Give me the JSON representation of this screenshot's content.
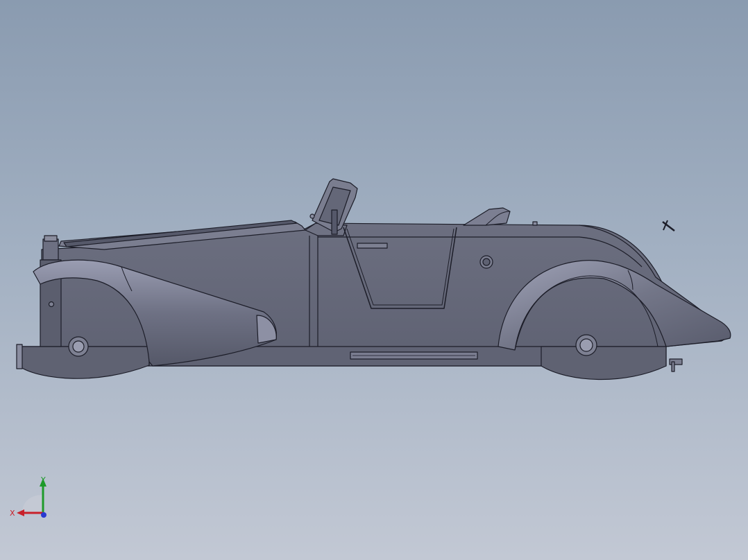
{
  "viewport": {
    "background_top": "#8a9bb0",
    "background_bottom": "#c2c8d4"
  },
  "model": {
    "body_color": "#646778",
    "edge_color": "#1c1d28",
    "highlight_color": "#8f92a8",
    "shadow_color": "#4a4c5a"
  },
  "triad": {
    "x_label": "X",
    "y_label": "Y",
    "x_color": "#c8202a",
    "y_color": "#1e9a2a",
    "z_color": "#2a3ad0",
    "icon": "coordinate-triad-icon"
  }
}
